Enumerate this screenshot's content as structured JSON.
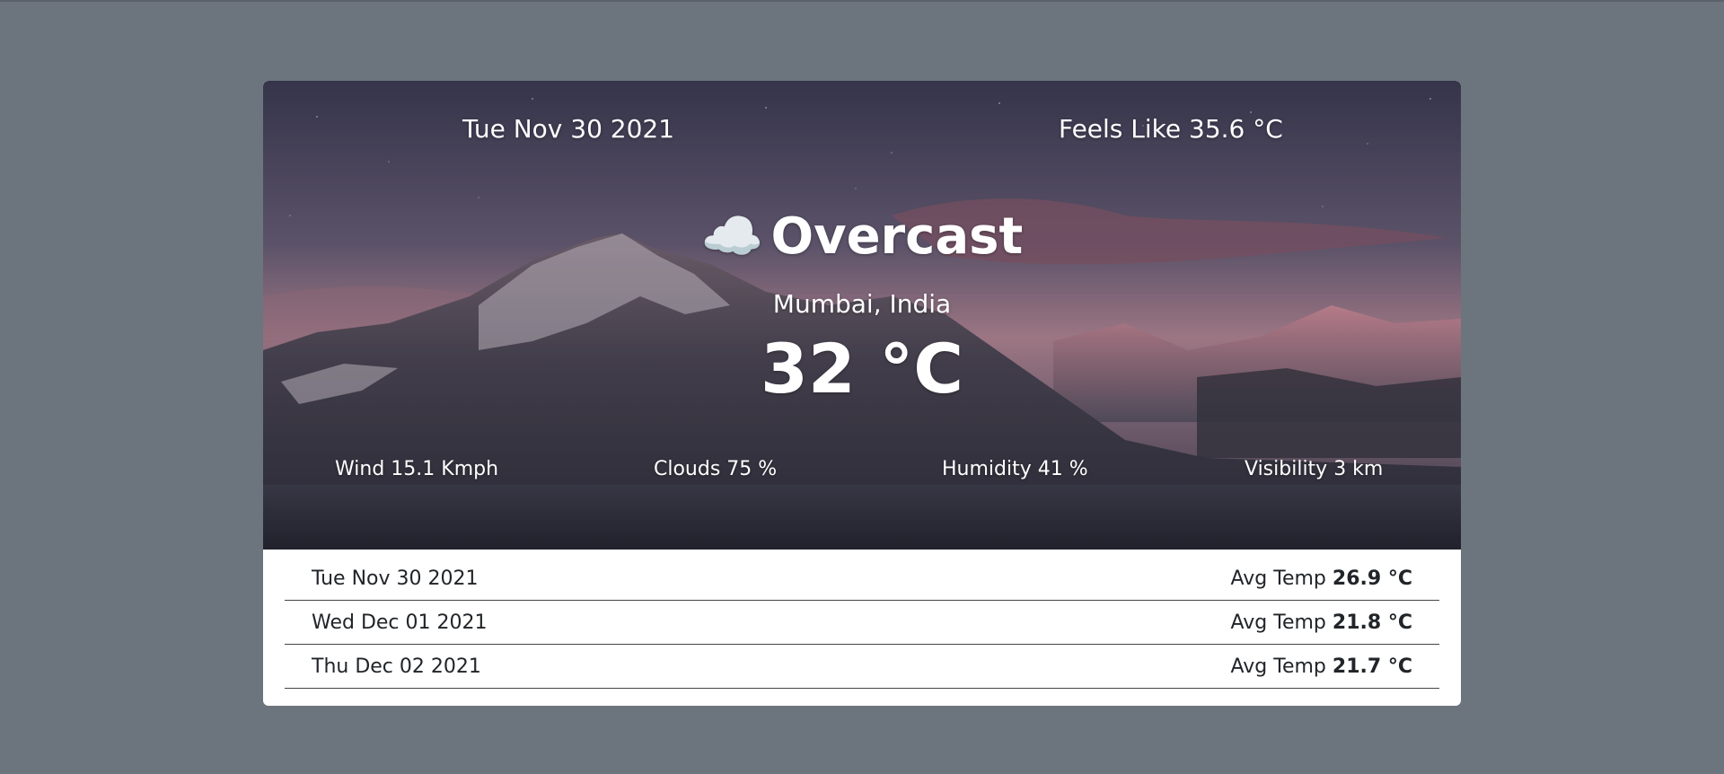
{
  "current": {
    "date": "Tue Nov 30 2021",
    "feels_like": "Feels Like 35.6 °C",
    "condition_icon": "☁️",
    "condition": "Overcast",
    "location": "Mumbai, India",
    "temperature": "32 °C"
  },
  "stats": {
    "wind": "Wind 15.1 Kmph",
    "clouds": "Clouds 75 %",
    "humidity": "Humidity 41 %",
    "visibility": "Visibility 3 km"
  },
  "forecast": [
    {
      "date": "Tue Nov 30 2021",
      "avg_label": "Avg Temp",
      "avg_value": "26.9 °C"
    },
    {
      "date": "Wed Dec 01 2021",
      "avg_label": "Avg Temp",
      "avg_value": "21.8 °C"
    },
    {
      "date": "Thu Dec 02 2021",
      "avg_label": "Avg Temp",
      "avg_value": "21.7 °C"
    }
  ],
  "colors": {
    "page_background": "#6c757d",
    "card_background": "#ffffff",
    "hero_text": "#ffffff",
    "forecast_text": "#212529"
  }
}
